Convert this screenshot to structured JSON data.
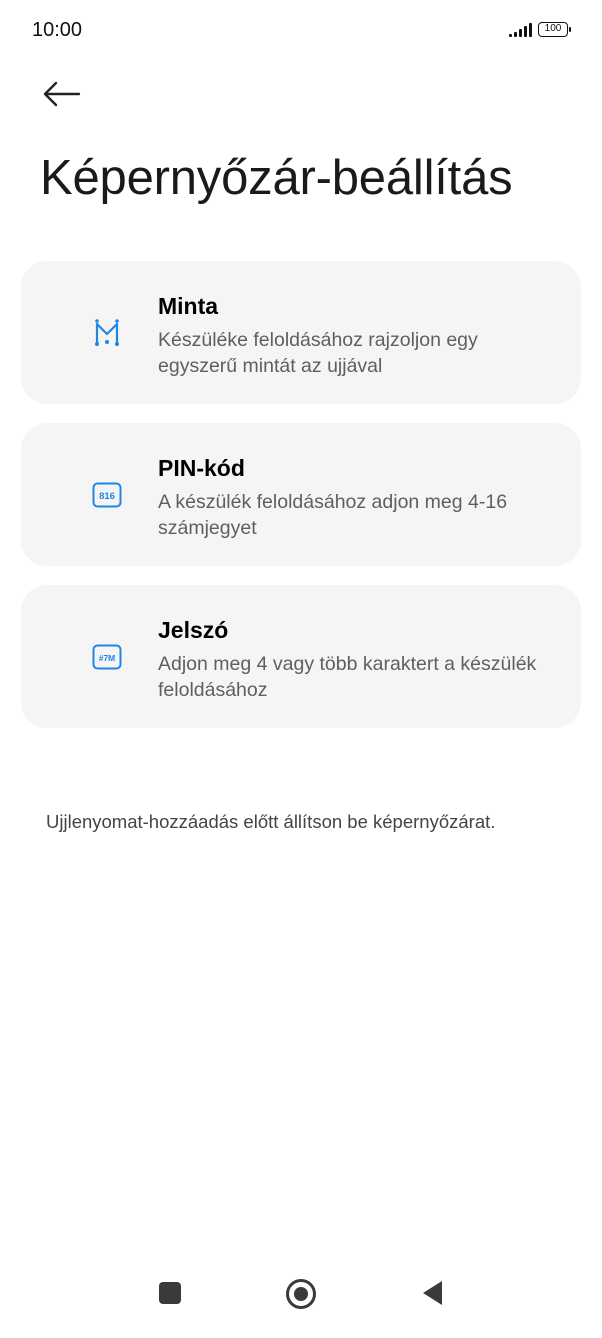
{
  "status_bar": {
    "time": "10:00",
    "battery": "100",
    "signal_icon": "signal-bars-icon"
  },
  "header": {
    "back_icon": "arrow-left-icon",
    "title": "Képernyőzár-beállítás"
  },
  "options": [
    {
      "icon": "pattern-icon",
      "title": "Minta",
      "description": "Készüléke feloldásához rajzoljon egy egyszerű mintát az ujjával"
    },
    {
      "icon": "pin-icon",
      "icon_text": "816",
      "title": "PIN-kód",
      "description": "A készülék feloldásához adjon meg 4-16 számjegyet"
    },
    {
      "icon": "password-icon",
      "icon_text": "#7M",
      "title": "Jelszó",
      "description": "Adjon meg 4 vagy több karaktert a készülék feloldásához"
    }
  ],
  "footer": {
    "note": "Ujjlenyomat-hozzáadás előtt állítson be képernyőzárat."
  },
  "colors": {
    "accent": "#1f86e5",
    "card_bg": "#f5f5f5",
    "secondary_text": "#5f5f5f"
  },
  "nav_bar": {
    "home_icon": "square-icon",
    "recents_icon": "circle-icon",
    "back_icon": "triangle-back-icon"
  }
}
